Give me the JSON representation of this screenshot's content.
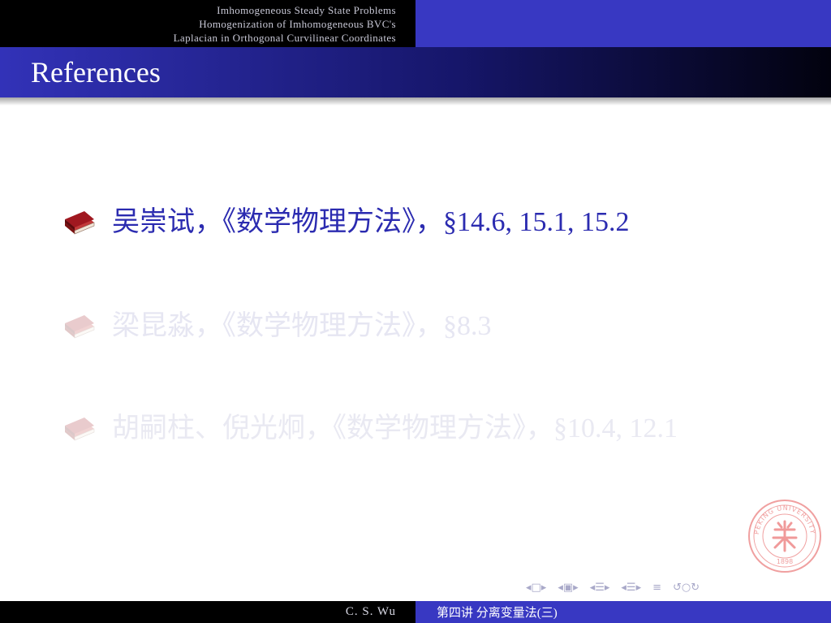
{
  "header": {
    "sections": [
      "Imhomogeneous Steady State Problems",
      "Homogenization of Imhomogeneous BVC's",
      "Laplacian in Orthogonal Curvilinear Coordinates"
    ]
  },
  "frame": {
    "title": "References"
  },
  "references": [
    {
      "text": "吴崇试，《数学物理方法》，§14.6, 15.1, 15.2"
    },
    {
      "text": "梁昆淼，《数学物理方法》，§8.3"
    },
    {
      "text": "胡嗣柱、倪光炯，《数学物理方法》，§10.4, 12.1"
    }
  ],
  "logo": {
    "text": "PEKING UNIVERSITY",
    "year": "1898"
  },
  "footer": {
    "author": "C. S. Wu",
    "lecture": "第四讲 分离变量法(三)"
  },
  "colors": {
    "accent": "#3838c2",
    "highlight_text": "#2b2bb0",
    "dim_text": "#e6e6f2",
    "book": "#a01820"
  },
  "nav_icons": [
    "nav-frame-icon",
    "nav-subsection-icon",
    "nav-section-icon",
    "nav-doc-icon",
    "nav-align-icon",
    "nav-search-icon"
  ]
}
